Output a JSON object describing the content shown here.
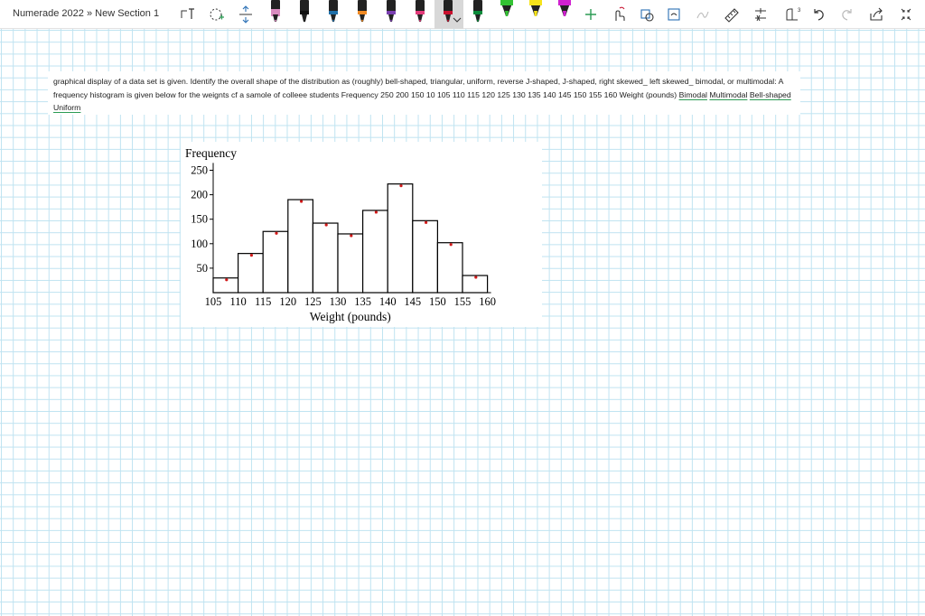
{
  "breadcrumb": {
    "notebook": "Numerade 2022",
    "separator": "»",
    "section": "New Section 1"
  },
  "question": {
    "text": "graphical display of a data set is given. Identify the overall shape of the distribution as (roughly) bell-shaped, triangular, uniform, reverse J-shaped, J-shaped, right skewed_ left skewed_ bimodal, or multimodal: A frequency histogram is given below for the weignts cf a samole of colleee students Frequency 250 200 150 10 105 110 115 120 125 130 135 140 145 150 155 160 Weight (pounds)",
    "options": [
      "Bimodal",
      "Multimodal",
      "Bell-shaped",
      "Uniform"
    ]
  },
  "pen_colors": [
    "#d98bbf",
    "#111111",
    "#1f6fa8",
    "#f08a24",
    "#7a3fb0",
    "#e23b7a",
    "#c8102e",
    "#0a8a3a",
    "#33c233",
    "#f6e31a",
    "#d020d0"
  ],
  "chart_data": {
    "type": "bar",
    "ylabel": "Frequency",
    "xlabel": "Weight (pounds)",
    "yticks": [
      "250",
      "200",
      "150",
      "100",
      "50"
    ],
    "ytick_values": [
      250,
      200,
      150,
      100,
      50
    ],
    "xticks": [
      "105",
      "110",
      "115",
      "120",
      "125",
      "130",
      "135",
      "140",
      "145",
      "150",
      "155",
      "160"
    ],
    "bins": [
      {
        "from": 105,
        "to": 110,
        "value": 30
      },
      {
        "from": 110,
        "to": 115,
        "value": 80
      },
      {
        "from": 115,
        "to": 120,
        "value": 125
      },
      {
        "from": 120,
        "to": 125,
        "value": 190
      },
      {
        "from": 125,
        "to": 130,
        "value": 142
      },
      {
        "from": 130,
        "to": 135,
        "value": 120
      },
      {
        "from": 135,
        "to": 140,
        "value": 168
      },
      {
        "from": 140,
        "to": 145,
        "value": 222
      },
      {
        "from": 145,
        "to": 150,
        "value": 147
      },
      {
        "from": 150,
        "to": 155,
        "value": 102
      },
      {
        "from": 155,
        "to": 160,
        "value": 35
      }
    ],
    "xlim": [
      105,
      160
    ],
    "ylim": [
      0,
      265
    ],
    "marker_color": "#d11a1a"
  }
}
